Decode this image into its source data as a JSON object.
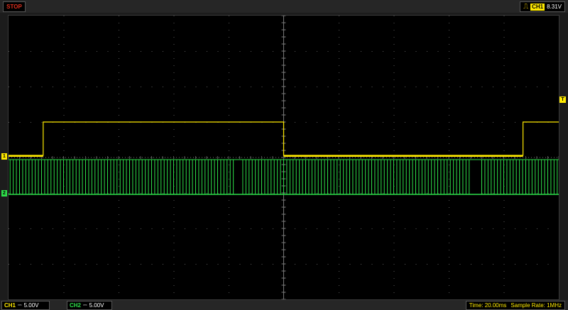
{
  "header": {
    "status": "STOP",
    "trigger": {
      "icon": "rising-edge-icon",
      "channel": "CH1",
      "level": "8.31V"
    }
  },
  "markers": {
    "ch1": "1",
    "ch2": "2",
    "trigger": "T"
  },
  "footer": {
    "ch1": {
      "name": "CH1",
      "coupling": "DC",
      "scale": "5.00V"
    },
    "ch2": {
      "name": "CH2",
      "coupling": "DC",
      "scale": "5.00V"
    },
    "time": "Time: 20.00ms",
    "sample_rate": "Sample Rate: 1MHz"
  },
  "colors": {
    "ch1": "#ffea00",
    "ch2": "#2ee04a",
    "status": "#e0301e",
    "grid": "#5a5a5a"
  },
  "traces": {
    "ch1_transitions": [
      0.063,
      0.5,
      0.935
    ],
    "ch1_start_level": "low",
    "ch2_gaps": [
      [
        0.41,
        0.425
      ],
      [
        0.84,
        0.855
      ]
    ],
    "ch2_pulse_count": 175
  }
}
